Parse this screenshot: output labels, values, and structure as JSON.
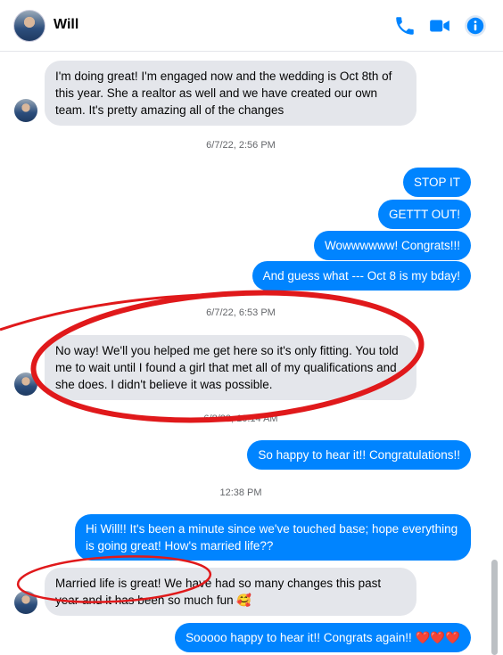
{
  "header": {
    "contact_name": "Will"
  },
  "messages": [
    {
      "id": "m1",
      "text": "I'm doing great! I'm engaged now and the wedding is Oct 8th of this year. She a realtor as well and we have created our own team. It's pretty amazing all of the changes"
    },
    {
      "id": "ts1",
      "text": "6/7/22, 2:56 PM"
    },
    {
      "id": "m2",
      "text": "STOP IT"
    },
    {
      "id": "m3",
      "text": "GETTT OUT!"
    },
    {
      "id": "m4",
      "text": "Wowwwwww! Congrats!!!"
    },
    {
      "id": "m5",
      "text": "And guess what --- Oct 8 is my bday!"
    },
    {
      "id": "ts2",
      "text": "6/7/22, 6:53 PM"
    },
    {
      "id": "m6",
      "text": "No way! We'll you helped me get here so it's only fitting.  You told me to wait until I found a girl that met all of my qualifications and she does. I didn't believe it was possible."
    },
    {
      "id": "ts3",
      "text": "6/8/22, 10:14 AM"
    },
    {
      "id": "m7",
      "text": "So happy to hear it!! Congratulations!!"
    },
    {
      "id": "ts4",
      "text": "12:38 PM"
    },
    {
      "id": "m8",
      "text": "Hi Will!! It's been a minute since we've touched base; hope everything is going great! How's married life??"
    },
    {
      "id": "m9",
      "text": "Married life is great! We have had so many changes this past year and it has been so much fun 🥰"
    },
    {
      "id": "m10",
      "text": "Sooooo happy to hear it!! Congrats again!! ❤️❤️❤️"
    }
  ],
  "colors": {
    "outgoing": "#0084ff",
    "incoming": "#e4e6eb",
    "annotation": "#e0191b",
    "icon": "#0084ff"
  },
  "icons": [
    "phone-icon",
    "video-camera-icon",
    "info-icon"
  ]
}
